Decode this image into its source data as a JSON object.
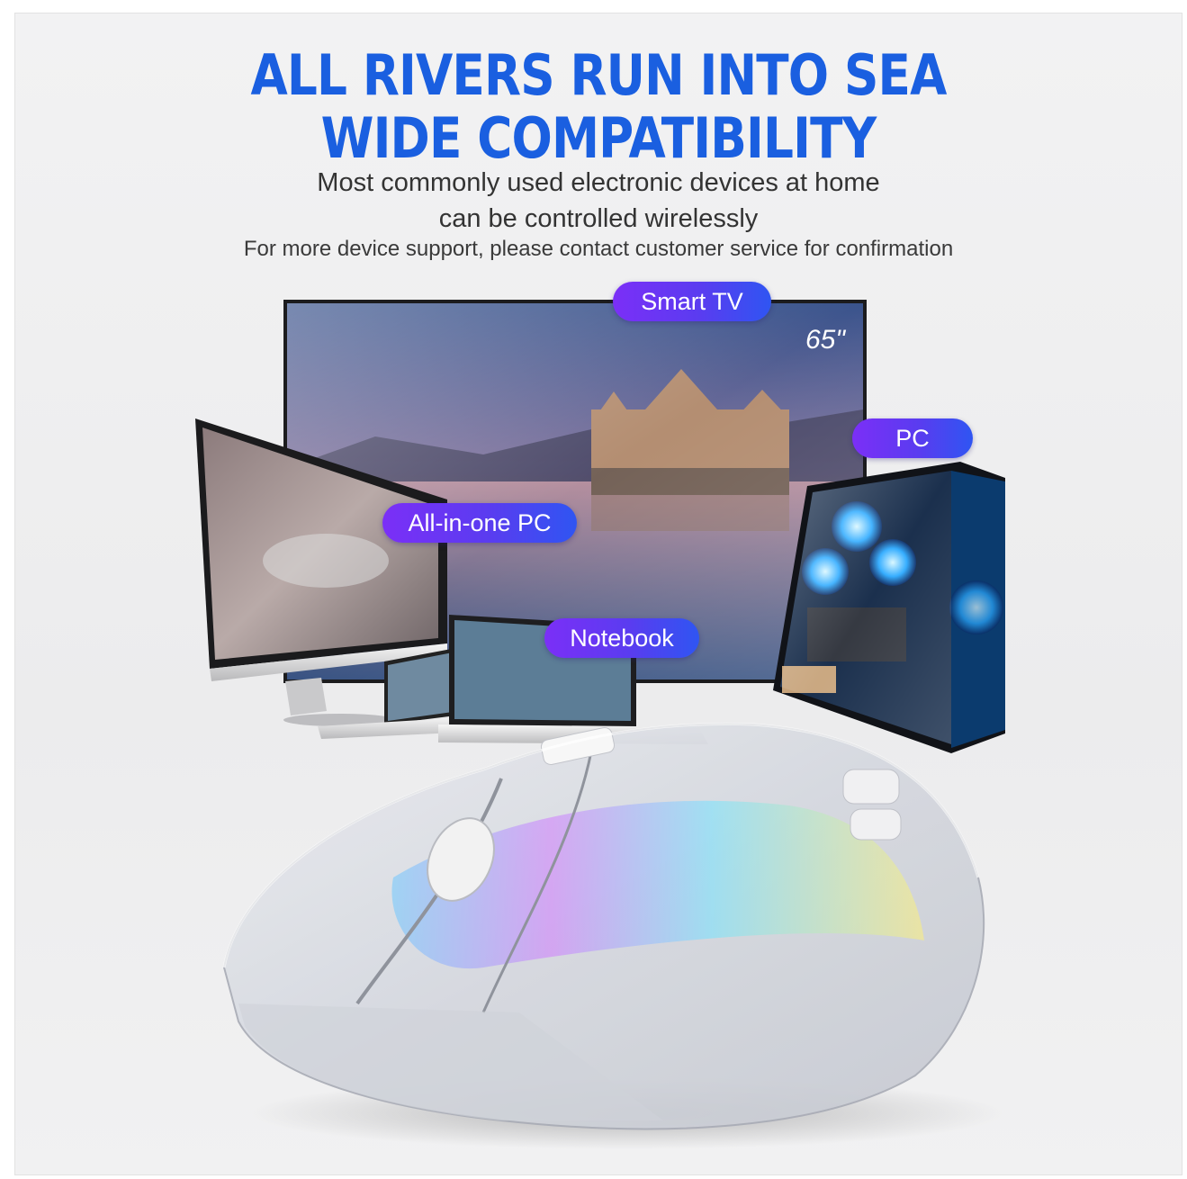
{
  "headline": {
    "line1": "ALL RIVERS RUN INTO SEA",
    "line2": "WIDE COMPATIBILITY"
  },
  "subtitle": {
    "line1": "Most commonly used electronic devices at home",
    "line2": "can be controlled wirelessly",
    "line3": "For more device support, please contact customer service for confirmation"
  },
  "devices": {
    "smart_tv": "Smart TV",
    "tv_size": "65\"",
    "pc": "PC",
    "all_in_one": "All-in-one PC",
    "notebook": "Notebook"
  },
  "colors": {
    "headline": "#1a5fe0",
    "pill_start": "#7b2ff7",
    "pill_end": "#2f55f2"
  }
}
